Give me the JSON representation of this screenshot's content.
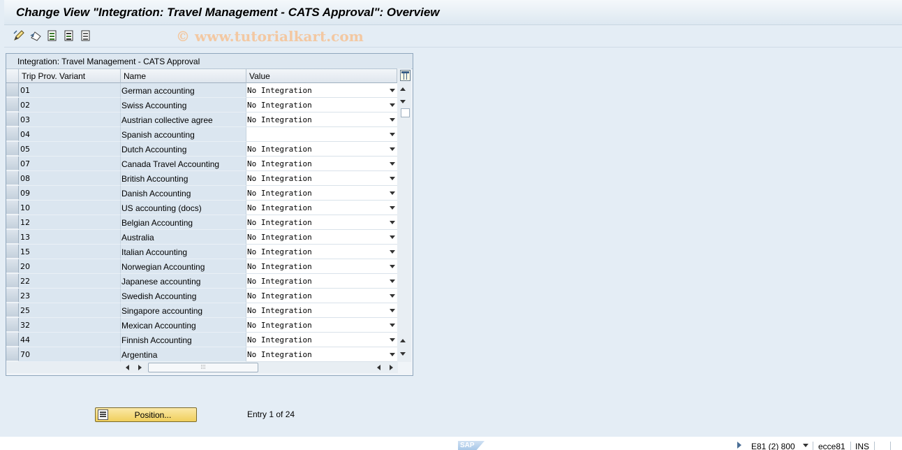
{
  "window": {
    "title": "Change View \"Integration: Travel Management - CATS Approval\": Overview"
  },
  "toolbar": {
    "icons": [
      "edit-pencil-icon",
      "undo-icon",
      "select-all-icon",
      "select-block-icon",
      "deselect-all-icon"
    ],
    "watermark": "© www.tutorialkart.com"
  },
  "table": {
    "title": "Integration: Travel Management - CATS Approval",
    "columns": [
      "Trip Prov. Variant",
      "Name",
      "Value"
    ],
    "rows": [
      {
        "variant": "01",
        "name": "German accounting",
        "value": "No Integration"
      },
      {
        "variant": "02",
        "name": "Swiss Accounting",
        "value": "No Integration"
      },
      {
        "variant": "03",
        "name": "Austrian collective agree",
        "value": "No Integration"
      },
      {
        "variant": "04",
        "name": "Spanish accounting",
        "value": ""
      },
      {
        "variant": "05",
        "name": "Dutch Accounting",
        "value": "No Integration"
      },
      {
        "variant": "07",
        "name": "Canada Travel Accounting",
        "value": "No Integration"
      },
      {
        "variant": "08",
        "name": "British Accounting",
        "value": "No Integration"
      },
      {
        "variant": "09",
        "name": "Danish Accounting",
        "value": "No Integration"
      },
      {
        "variant": "10",
        "name": "US accounting (docs)",
        "value": "No Integration"
      },
      {
        "variant": "12",
        "name": "Belgian Accounting",
        "value": "No Integration"
      },
      {
        "variant": "13",
        "name": "Australia",
        "value": "No Integration"
      },
      {
        "variant": "15",
        "name": "Italian Accounting",
        "value": "No Integration"
      },
      {
        "variant": "20",
        "name": "Norwegian Accounting",
        "value": "No Integration"
      },
      {
        "variant": "22",
        "name": "Japanese accounting",
        "value": "No Integration"
      },
      {
        "variant": "23",
        "name": "Swedish Accounting",
        "value": "No Integration"
      },
      {
        "variant": "25",
        "name": "Singapore accounting",
        "value": "No Integration"
      },
      {
        "variant": "32",
        "name": "Mexican Accounting",
        "value": "No Integration"
      },
      {
        "variant": "44",
        "name": "Finnish Accounting",
        "value": "No Integration"
      },
      {
        "variant": "70",
        "name": "Argentina",
        "value": "No Integration"
      }
    ]
  },
  "footer": {
    "position_button": "Position...",
    "entry_text": "Entry 1 of 24"
  },
  "statusbar": {
    "system": "E81 (2) 800",
    "server": "ecce81",
    "mode": "INS"
  },
  "colors": {
    "background": "#e4edf5",
    "key_cell": "#dbe6f0",
    "button": "#f0cf5c"
  }
}
